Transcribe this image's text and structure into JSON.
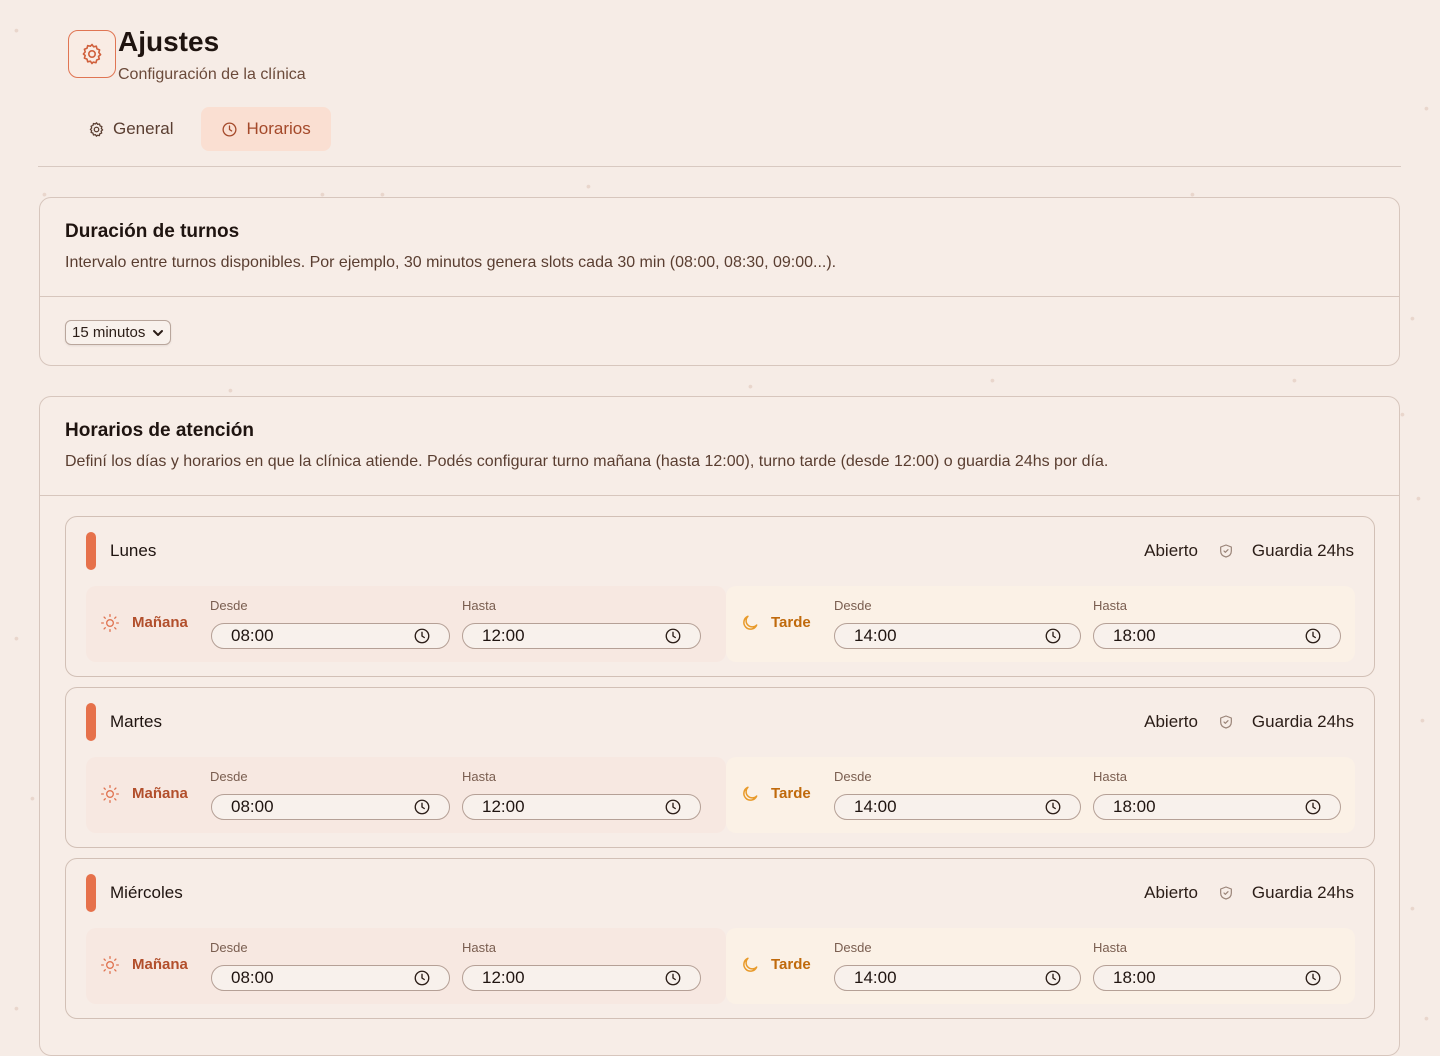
{
  "header": {
    "title": "Ajustes",
    "subtitle": "Configuración de la clínica",
    "icon": "gear-icon"
  },
  "tabs": [
    {
      "label": "General",
      "icon": "gear-icon",
      "active": false
    },
    {
      "label": "Horarios",
      "icon": "clock-icon",
      "active": true
    }
  ],
  "duration": {
    "title": "Duración de turnos",
    "description": "Intervalo entre turnos disponibles. Por ejemplo, 30 minutos genera slots cada 30 min (08:00, 08:30, 09:00...).",
    "select_value": "15 minutos"
  },
  "schedule": {
    "title": "Horarios de atención",
    "description": "Definí los días y horarios en que la clínica atiende. Podés configurar turno mañana (hasta 12:00), turno tarde (desde 12:00) o guardia 24hs por día.",
    "labels": {
      "morning": "Mañana",
      "afternoon": "Tarde",
      "from": "Desde",
      "to": "Hasta",
      "open": "Abierto",
      "guard": "Guardia 24hs"
    },
    "days": [
      {
        "name": "Lunes",
        "morning_from": "08:00",
        "morning_to": "12:00",
        "afternoon_from": "14:00",
        "afternoon_to": "18:00"
      },
      {
        "name": "Martes",
        "morning_from": "08:00",
        "morning_to": "12:00",
        "afternoon_from": "14:00",
        "afternoon_to": "18:00"
      },
      {
        "name": "Miércoles",
        "morning_from": "08:00",
        "morning_to": "12:00",
        "afternoon_from": "14:00",
        "afternoon_to": "18:00"
      }
    ]
  },
  "colors": {
    "accent": "#e6714b",
    "morning_text": "#b24f2c",
    "afternoon_text": "#c06a0c",
    "background": "#f6ece6"
  }
}
